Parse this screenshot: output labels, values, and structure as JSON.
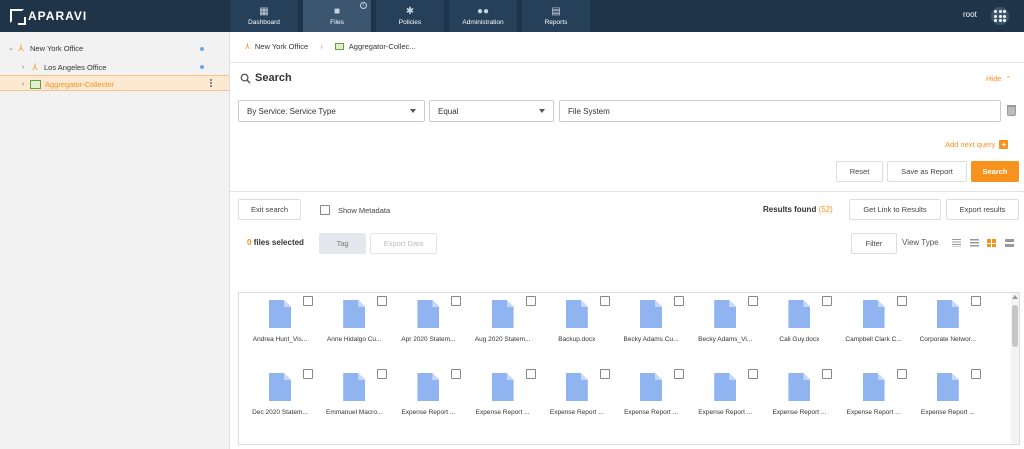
{
  "app": {
    "brand": "APARAVI",
    "accent_color": "#f7921e",
    "topbar_color": "#1f3349"
  },
  "nav": [
    {
      "label": "Dashboard",
      "icon": "dashboard-icon"
    },
    {
      "label": "Files",
      "icon": "folder-icon",
      "active": true
    },
    {
      "label": "Policies",
      "icon": "gear-icon"
    },
    {
      "label": "Administration",
      "icon": "users-icon"
    },
    {
      "label": "Reports",
      "icon": "report-icon"
    }
  ],
  "user": {
    "name": "root"
  },
  "tree": [
    {
      "label": "New York Office",
      "icon": "node-icon",
      "expanded": true
    },
    {
      "label": "Los Angeles Office",
      "icon": "node-icon"
    },
    {
      "label": "Aggregator-Collector",
      "icon": "collector-icon",
      "selected": true
    }
  ],
  "breadcrumb": [
    "New York Office",
    "Aggregator-Collec..."
  ],
  "search": {
    "title": "Search",
    "hide_label": "Hide",
    "field": "By Service: Service Type",
    "operator": "Equal",
    "value": "File System",
    "add_query_label": "Add next query",
    "reset_label": "Reset",
    "save_report_label": "Save as Report",
    "search_label": "Search"
  },
  "results": {
    "exit_search_label": "Exit search",
    "show_metadata_label": "Show Metadata",
    "results_found_label": "Results found",
    "results_count": "(52)",
    "get_link_label": "Get Link to Results",
    "export_results_label": "Export results",
    "files_selected_count": "0",
    "files_selected_label": "files selected",
    "tag_label": "Tag",
    "export_data_label": "Export Data",
    "filter_label": "Filter",
    "view_type_label": "View Type",
    "view_modes": [
      "compact-list-icon",
      "list-icon",
      "grid-icon",
      "large-rows-icon"
    ],
    "active_view": "grid-icon"
  },
  "files": [
    "Andrea Hunt_Vis...",
    "Anne Hidalgo Cu...",
    "Apr 2020 Statem...",
    "Aug 2020 Statem...",
    "Backup.docx",
    "Becky Adams Cu...",
    "Becky Adams_Vi...",
    "Cali Guy.docx",
    "Campbell Clark C...",
    "Corporate Networ...",
    "Dec 2020 Statem...",
    "Emmanuel Macro...",
    "Expense Report ...",
    "Expense Report ...",
    "Expense Report ...",
    "Expense Report ...",
    "Expense Report ...",
    "Expense Report ...",
    "Expense Report ...",
    "Expense Report ..."
  ]
}
